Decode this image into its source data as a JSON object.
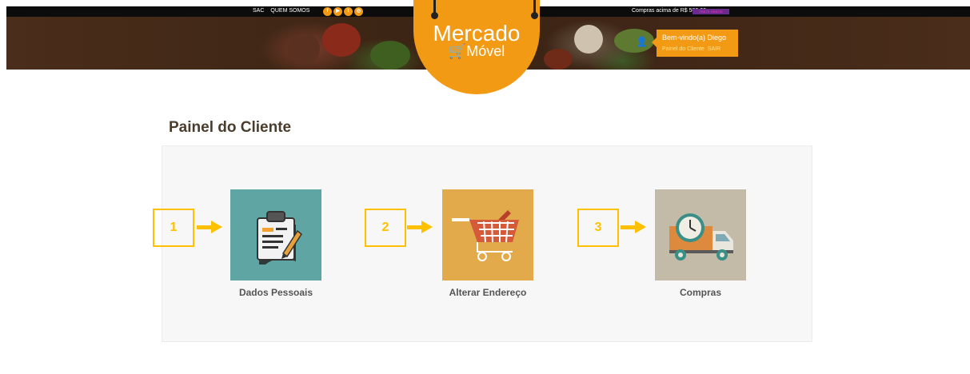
{
  "topbar": {
    "links": [
      "SAC",
      "QUEM SOMOS"
    ],
    "social_icons": [
      "facebook-icon",
      "youtube-icon",
      "twitter-icon",
      "instagram-icon"
    ],
    "promo": "Compras acima de R$ 500,00",
    "promo_badge": "FRETE GRÁTIS"
  },
  "logo": {
    "line1": "Mercado",
    "line2": "Móvel"
  },
  "user": {
    "welcome": "Bem-vindo(a) Diego",
    "panel_link": "Painel do Cliente",
    "logout": "SAIR"
  },
  "page": {
    "title": "Painel do Cliente"
  },
  "cards": [
    {
      "number": "1",
      "label": "Dados Pessoais",
      "icon": "clipboard-icon",
      "color": "#5fa5a3"
    },
    {
      "number": "2",
      "label": "Alterar Endereço",
      "icon": "shopping-cart-icon",
      "color": "#e2aa4b"
    },
    {
      "number": "3",
      "label": "Compras",
      "icon": "delivery-truck-icon",
      "color": "#c3bba8"
    }
  ],
  "colors": {
    "accent": "#f39a15",
    "annotation": "#ffc000"
  }
}
